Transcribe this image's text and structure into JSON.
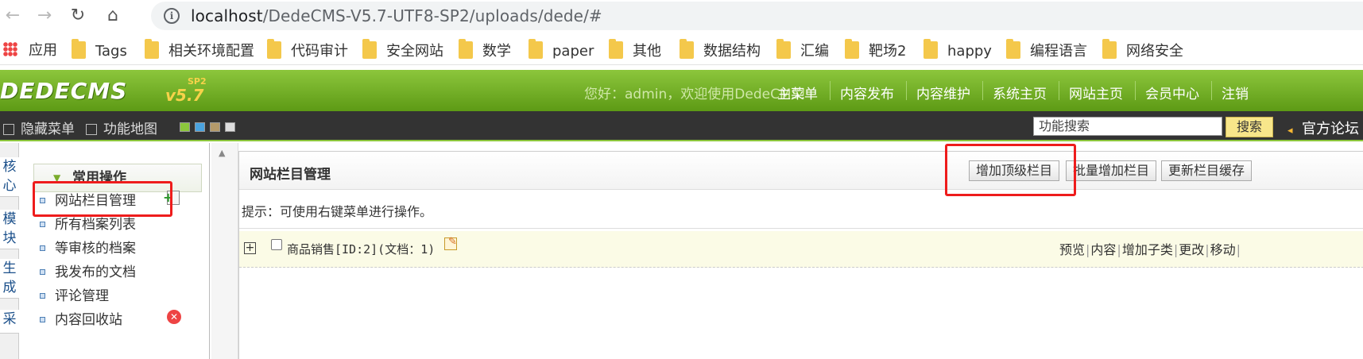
{
  "browser": {
    "url_host": "localhost",
    "url_path": "/DedeCMS-V5.7-UTF8-SP2/uploads/dede/#",
    "bookmarks": [
      "应用",
      "Tags",
      "相关环境配置",
      "代码审计",
      "安全网站",
      "数学",
      "paper",
      "其他",
      "数据结构",
      "汇编",
      "靶场2",
      "happy",
      "编程语言",
      "网络安全"
    ]
  },
  "header": {
    "logo": "DEDECMS",
    "version": "v5.7",
    "version_tag": "SP2",
    "welcome": "您好：admin，欢迎使用DedeCMS！",
    "menu": [
      "主菜单",
      "内容发布",
      "内容维护",
      "系统主页",
      "网站主页",
      "会员中心",
      "注销"
    ]
  },
  "toolbar": {
    "hide_menu": "隐藏菜单",
    "function_map": "功能地图",
    "search_placeholder": "功能搜索",
    "search_button": "搜索",
    "forum": "官方论坛"
  },
  "left_tabs": [
    "核心",
    "模块",
    "生成",
    "采"
  ],
  "menu": {
    "section": "常用操作",
    "items": [
      "网站栏目管理",
      "所有档案列表",
      "等审核的档案",
      "我发布的文档",
      "评论管理",
      "内容回收站"
    ]
  },
  "main": {
    "title": "网站栏目管理",
    "buttons": [
      "增加顶级栏目",
      "批量增加栏目",
      "更新栏目缓存"
    ],
    "tip": "提示：可使用右键菜单进行操作。",
    "category": {
      "label": "商品销售[ID:2](文档：1)",
      "actions": [
        "预览",
        "内容",
        "增加子类",
        "更改",
        "移动"
      ]
    }
  },
  "colors": {
    "header_green": "#7ab52b",
    "dark_bar": "#333333",
    "highlight_red": "#ee1c1c"
  }
}
